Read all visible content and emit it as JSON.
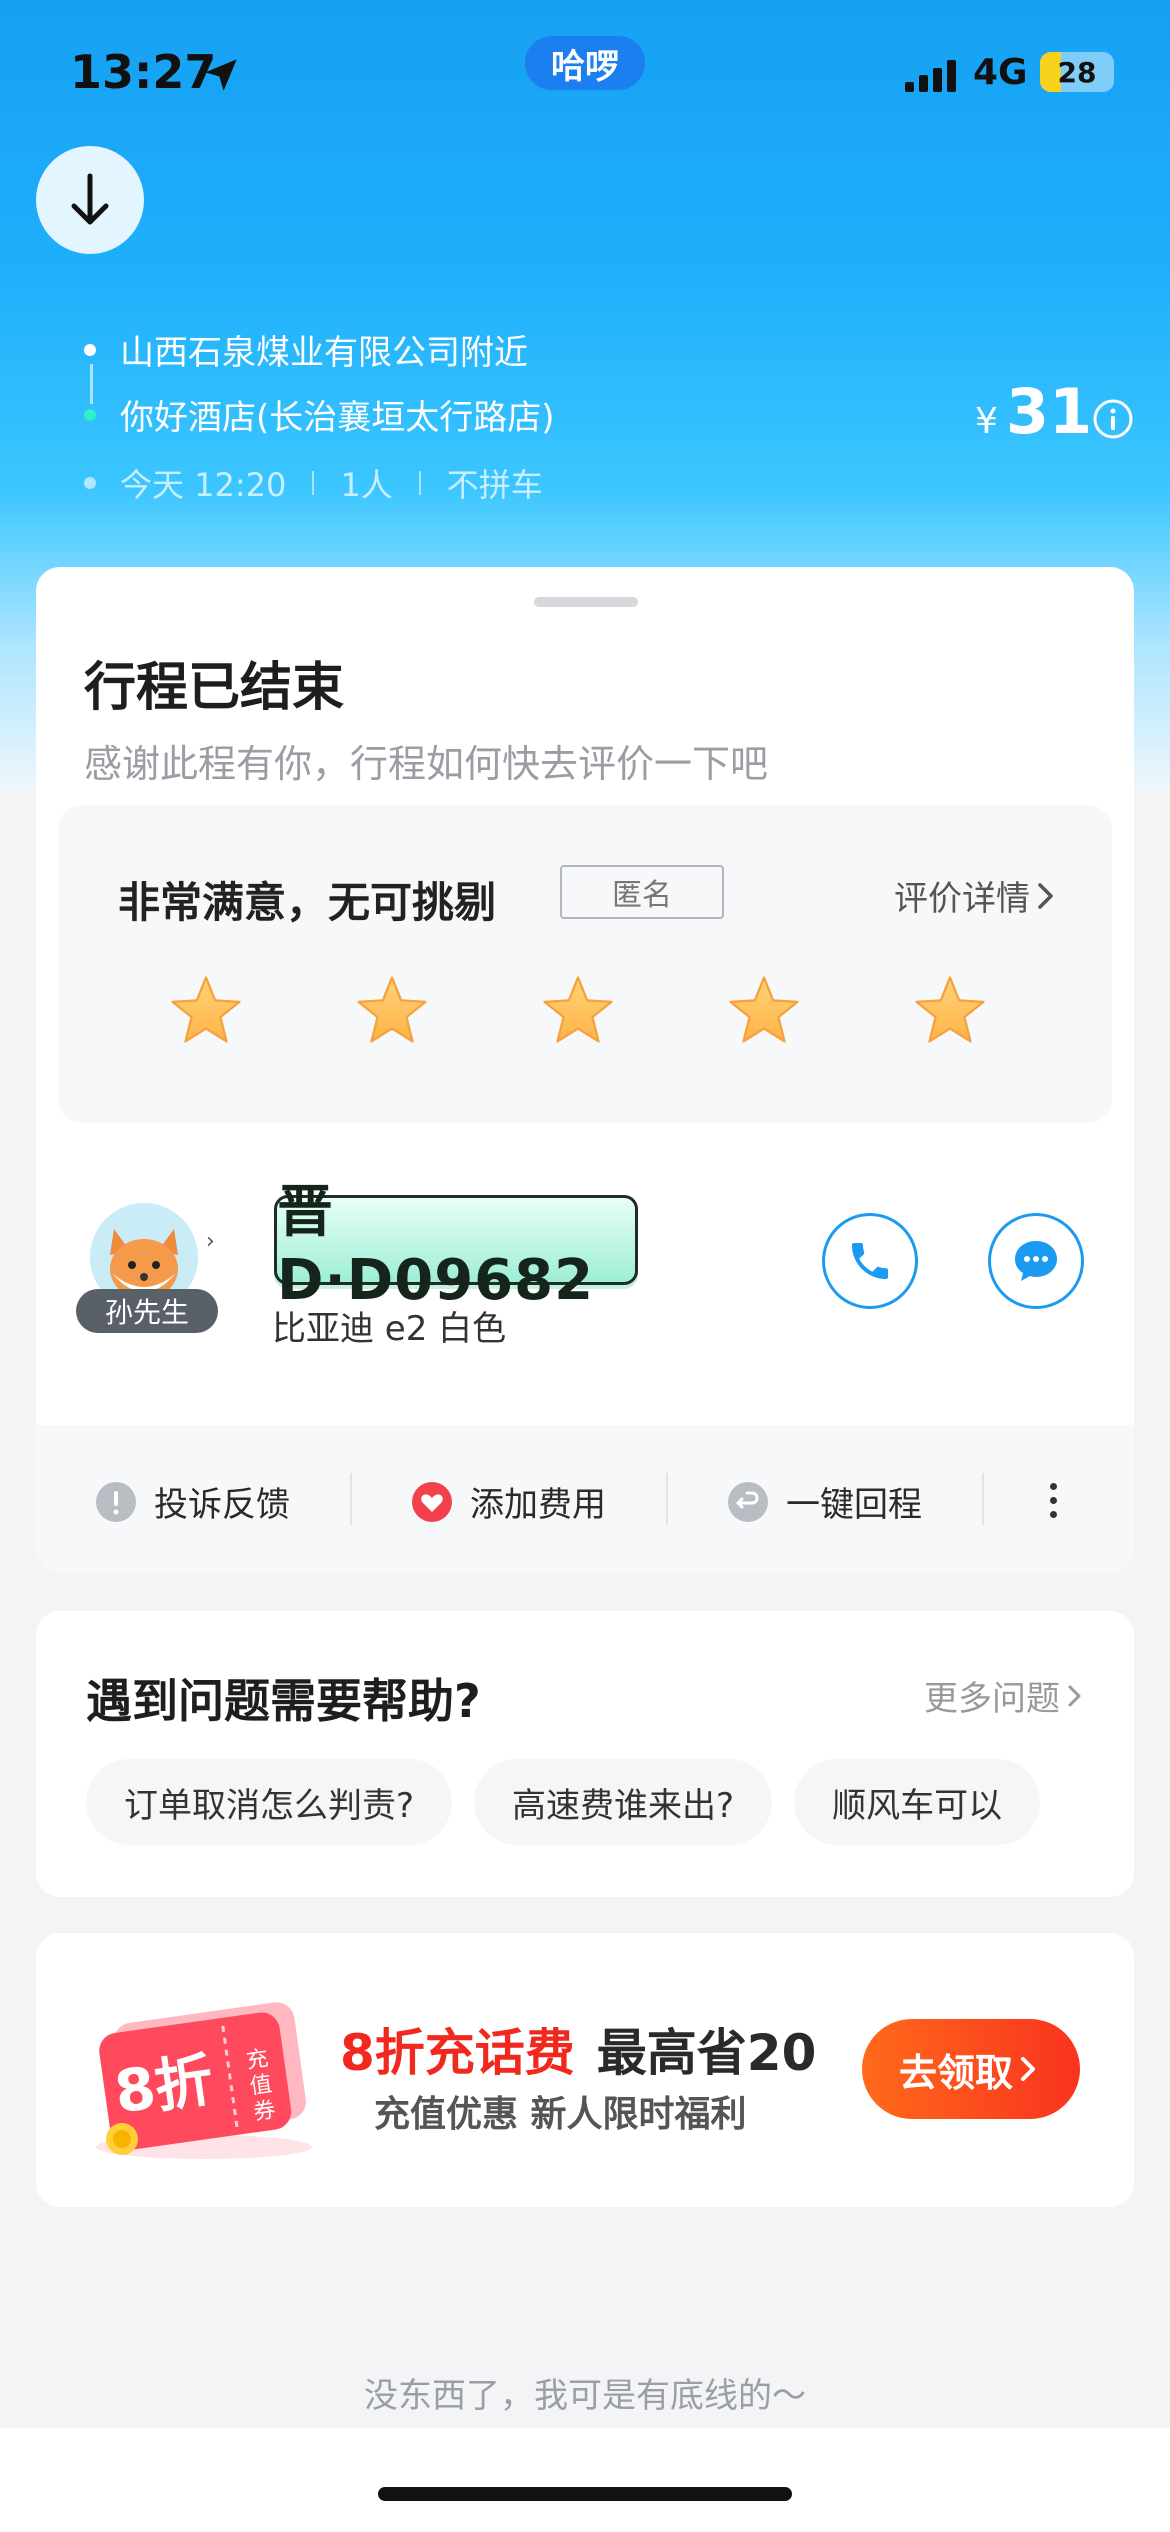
{
  "status_bar": {
    "time": "13:27",
    "app_name": "哈啰",
    "network": "4G",
    "battery": "28",
    "battery_level": 0.28
  },
  "trip": {
    "from": "山西石泉煤业有限公司附近",
    "to": "你好酒店(长治襄垣太行路店)",
    "time": "今天 12:20",
    "passengers": "1人",
    "carpool": "不拼车",
    "price_symbol": "¥",
    "price": "31"
  },
  "main_card": {
    "title": "行程已结束",
    "subtitle": "感谢此程有你，行程如何快去评价一下吧",
    "rating": {
      "text": "非常满意，无可挑剔",
      "anonymous_tag": "匿名",
      "detail_link": "评价详情",
      "stars": 5
    },
    "driver": {
      "name": "孙先生",
      "plate": "晋D·D09682",
      "car": "比亚迪 e2 白色"
    },
    "actions": [
      {
        "label": "投诉反馈"
      },
      {
        "label": "添加费用"
      },
      {
        "label": "一键回程"
      }
    ]
  },
  "help": {
    "title": "遇到问题需要帮助?",
    "more": "更多问题",
    "chips": [
      "订单取消怎么判责?",
      "高速费谁来出?",
      "顺风车可以"
    ]
  },
  "promo": {
    "badge_text": "8折",
    "badge_sub": "充值券",
    "headline_red": "8折充话费",
    "headline_dark": "最高省20",
    "subline": "充值优惠 新人限时福利",
    "button": "去领取"
  },
  "footer": "没东西了，我可是有底线的～",
  "colors": {
    "accent_blue": "#1a9af0",
    "promo_red": "#f0281e",
    "star_orange": "#ffb347"
  }
}
